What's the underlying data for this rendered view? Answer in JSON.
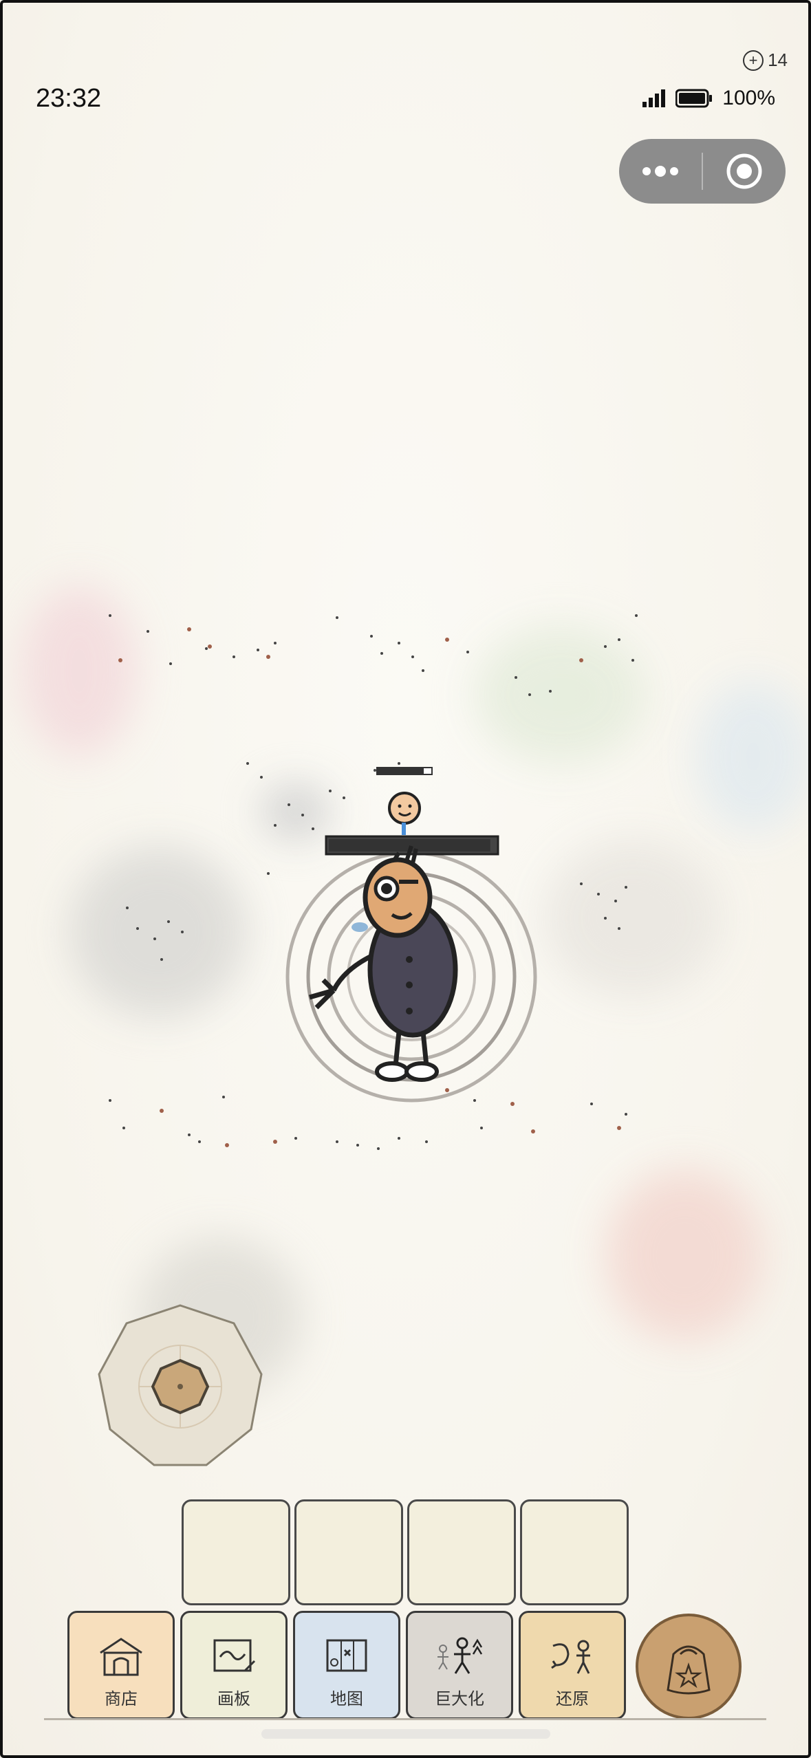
{
  "status_bar": {
    "time": "23:32",
    "battery": "100%",
    "notification_count": "14"
  },
  "capsule": {
    "more_icon": "more-dots-icon",
    "close_icon": "target-close-icon"
  },
  "toolbar": {
    "items": [
      {
        "label": "商店",
        "icon": "shop-icon"
      },
      {
        "label": "画板",
        "icon": "drawing-board-icon"
      },
      {
        "label": "地图",
        "icon": "map-icon"
      },
      {
        "label": "巨大化",
        "icon": "giant-icon"
      },
      {
        "label": "还原",
        "icon": "restore-icon"
      }
    ],
    "bag_icon": "backpack-icon",
    "empty_slots": 4
  },
  "player": {
    "health_fraction": 0.97,
    "enemy_health_fraction": 0.85
  }
}
